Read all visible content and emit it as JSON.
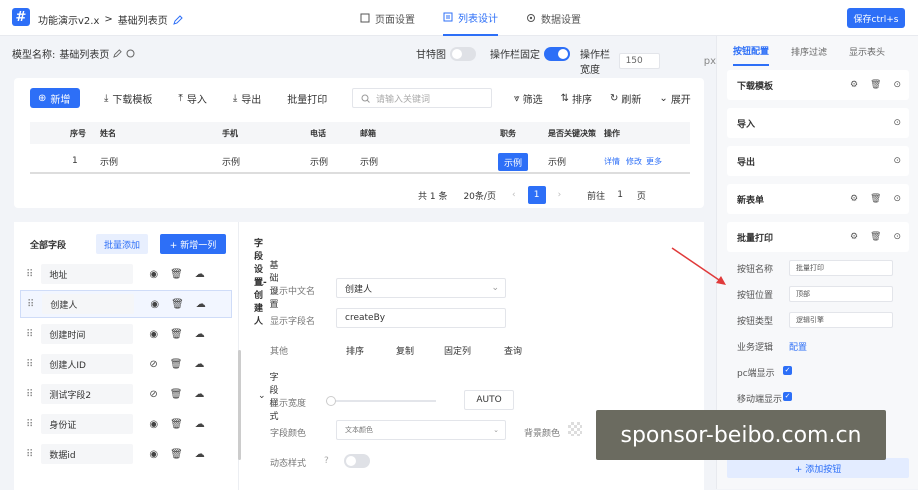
{
  "header": {
    "app_name": "功能演示v2.x",
    "separator": ">",
    "page_name": "基础列表页",
    "tabs": [
      "页面设置",
      "列表设计",
      "数据设置"
    ],
    "save_label": "保存ctrl+s"
  },
  "config_bar": {
    "model_label": "模型名称:",
    "model_value": "基础列表页",
    "gantt_label": "甘特图",
    "fixed_label": "操作栏固定",
    "width_label": "操作栏宽度",
    "width_value": "150",
    "width_unit": "px"
  },
  "preview": {
    "toolbar": [
      "新增",
      "下载模板",
      "导入",
      "导出",
      "批量打印"
    ],
    "search_placeholder": "请输入关键词",
    "tools": [
      "筛选",
      "排序",
      "刷新",
      "展开"
    ],
    "columns": [
      "序号",
      "姓名",
      "手机",
      "电话",
      "邮箱",
      "职务",
      "是否关键决策",
      "操作"
    ],
    "row": {
      "index": "1",
      "name": "示例",
      "mobile": "示例",
      "phone": "示例",
      "email": "示例",
      "title": "示例",
      "key": "示例",
      "actions": [
        "详情",
        "修改",
        "更多"
      ]
    },
    "pager": {
      "total": "共 1 条",
      "size": "20条/页",
      "current": "1",
      "goto_label": "前往",
      "goto_value": "1",
      "page_unit": "页"
    }
  },
  "fields": {
    "title": "全部字段",
    "batch_add": "批量添加",
    "add_col": "+ 新增一列",
    "items": [
      "地址",
      "创建人",
      "创建时间",
      "创建人ID",
      "测试字段2",
      "身份证",
      "数据id"
    ]
  },
  "detail": {
    "title": "字段设置-创建人",
    "basic_section": "基础设置",
    "cn_name_label": "显示中文名",
    "cn_name_value": "创建人",
    "field_name_label": "显示字段名",
    "field_name_value": "createBy",
    "other_label": "其他",
    "other_opts": [
      "排序",
      "复制",
      "固定列",
      "查询"
    ],
    "style_section": "字段样式",
    "width_label": "显示宽度",
    "width_value": "AUTO",
    "color_label": "字段颜色",
    "color_placeholder": "文本颜色",
    "bg_label": "背景颜色",
    "dynamic_label": "动态样式"
  },
  "right_panel": {
    "tabs": [
      "按钮配置",
      "排序过滤",
      "显示表头"
    ],
    "cards": [
      "下载模板",
      "导入",
      "导出",
      "新表单",
      "批量打印"
    ],
    "btn_name_label": "按钮名称",
    "btn_name_value": "批量打印",
    "btn_pos_label": "按钮位置",
    "btn_pos_value": "顶部",
    "btn_type_label": "按钮类型",
    "btn_type_value": "逻辑引擎",
    "logic_label": "业务逻辑",
    "logic_link": "配置",
    "pc_label": "pc端显示",
    "mobile_label": "移动端显示",
    "add_btn": "+ 添加按钮"
  },
  "watermark": "sponsor-beibo.com.cn",
  "colors": {
    "accent": "#2d6ff7"
  }
}
